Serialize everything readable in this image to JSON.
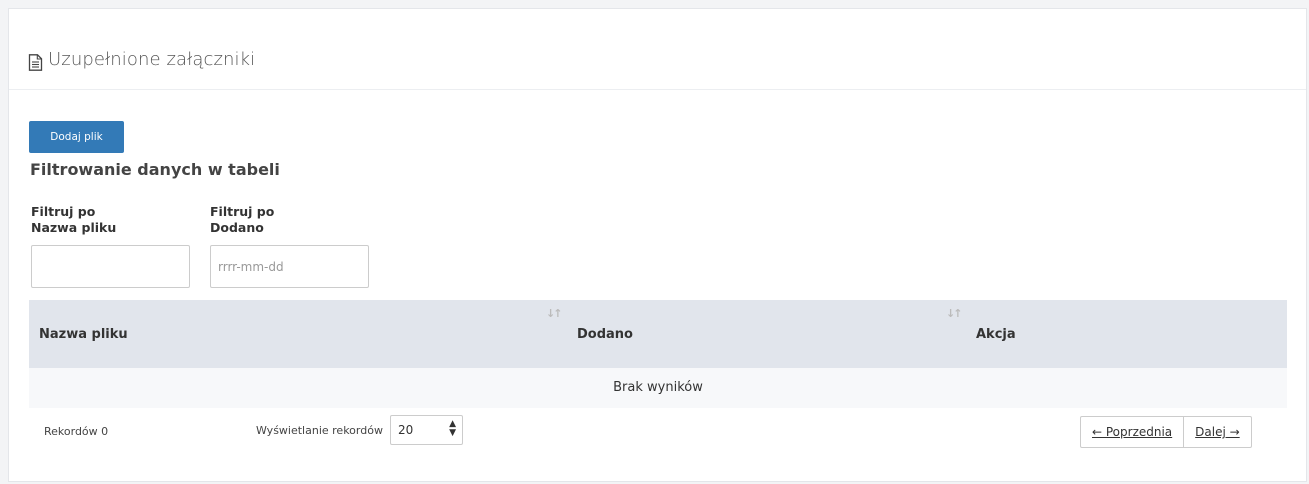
{
  "panel": {
    "title": "Uzupełnione załączniki",
    "title_icon": "document-icon"
  },
  "toolbar": {
    "add_file_label": "Dodaj plik"
  },
  "filters": {
    "heading": "Filtrowanie danych w tabeli",
    "items": [
      {
        "label_line1": "Filtruj po",
        "label_line2": "Nazwa pliku",
        "value": "",
        "placeholder": ""
      },
      {
        "label_line1": "Filtruj po",
        "label_line2": "Dodano",
        "value": "",
        "placeholder": "rrrr-mm-dd"
      }
    ]
  },
  "table": {
    "columns": [
      {
        "label": "Nazwa pliku",
        "sortable": false
      },
      {
        "label": "Dodano",
        "sortable": true,
        "sort_icon": "sort-icon"
      },
      {
        "label": "Akcja",
        "sortable": true,
        "sort_icon": "sort-icon"
      }
    ],
    "rows": [],
    "empty_text": "Brak wyników"
  },
  "footer": {
    "records_label": "Rekordów 0",
    "page_size_label": "Wyświetlanie rekordów",
    "page_size_value": "20",
    "prev_label": "← Poprzednia",
    "next_label": "Dalej →"
  },
  "colors": {
    "primary": "#337ab7",
    "table_header_bg": "#e1e5ec",
    "empty_row_bg": "#f7f8fa"
  }
}
